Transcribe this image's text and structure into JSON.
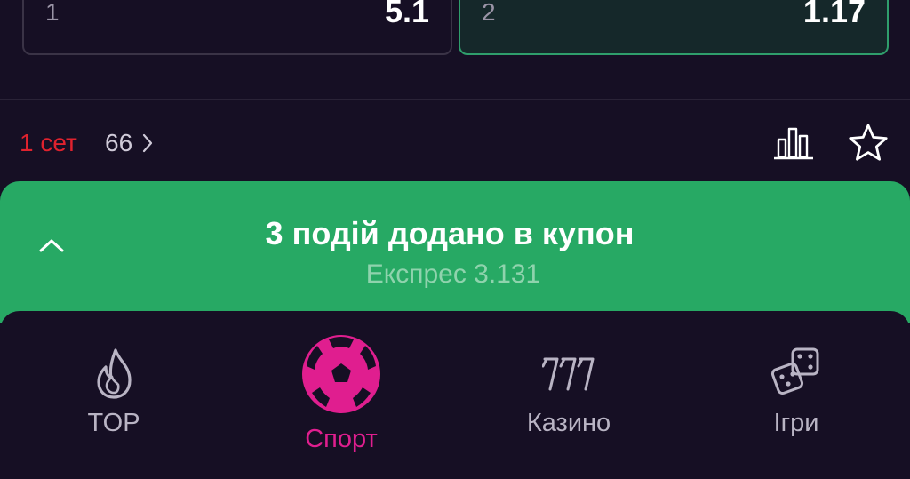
{
  "odds": [
    {
      "label": "1",
      "value": "5.1"
    },
    {
      "label": "2",
      "value": "1.17"
    }
  ],
  "match": {
    "set": "1 сет",
    "markets_count": "66"
  },
  "coupon": {
    "title": "3 подій додано в купон",
    "subtitle": "Експрес 3.131"
  },
  "nav": {
    "items": [
      {
        "label": "TOP",
        "icon": "flame-icon"
      },
      {
        "label": "Спорт",
        "icon": "soccer-ball-icon",
        "active": true
      },
      {
        "label": "Казино",
        "icon": "slots-777-icon"
      },
      {
        "label": "Ігри",
        "icon": "dice-icon"
      }
    ]
  },
  "colors": {
    "background": "#160f24",
    "accent_green": "#27a964",
    "accent_pink": "#e01e8f",
    "live_red": "#e0222e",
    "selected_border": "#2f9e6c"
  }
}
